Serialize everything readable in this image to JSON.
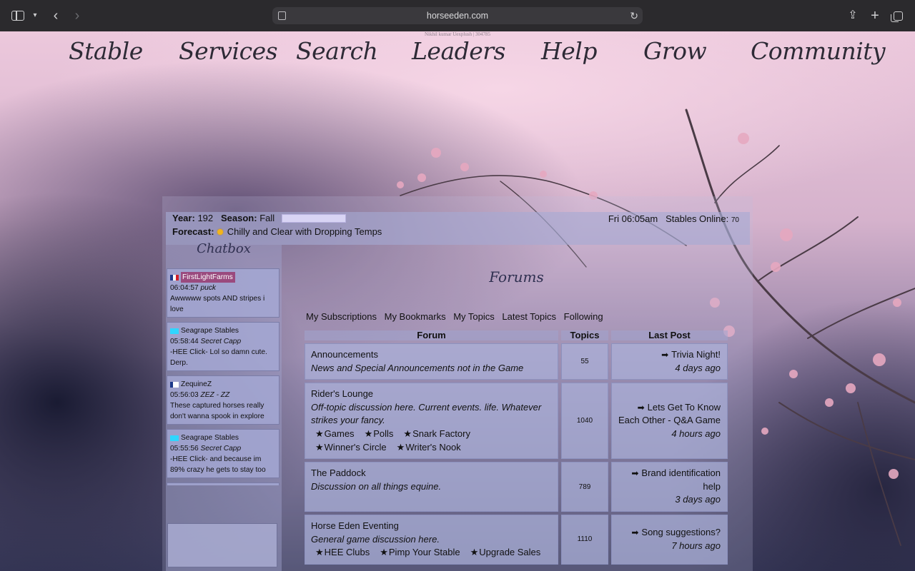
{
  "browser": {
    "url": "horseeden.com",
    "icons": {
      "sidebar": "sidebar-icon",
      "back": "chevron-left-icon",
      "forward": "chevron-right-icon",
      "share": "share-icon",
      "new_tab": "plus-icon",
      "tabs": "tabs-overview-icon"
    }
  },
  "annotation": "Nikhil kumar Uexplush | 304785",
  "nav": {
    "stable": "Stable",
    "services": "Services",
    "search": "Search",
    "leaders": "Leaders",
    "help": "Help",
    "grow": "Grow",
    "community": "Community"
  },
  "info": {
    "year_label": "Year:",
    "year": "192",
    "season_label": "Season:",
    "season": "Fall",
    "forecast_label": "Forecast:",
    "forecast": "Chilly and Clear with Dropping Temps",
    "time": "Fri 06:05am",
    "stables_online_label": "Stables Online:",
    "stables_online": "70"
  },
  "chatbox": {
    "title": "Chatbox",
    "messages": [
      {
        "user": "FirstLightFarms",
        "time": "06:04:57",
        "alias": "puck",
        "text": "Awwwww spots AND stripes i love"
      },
      {
        "user": "Seagrape Stables",
        "time": "05:58:44",
        "alias": "Secret Capp",
        "text": "-HEE Click- Lol so damn cute. Derp."
      },
      {
        "user": "ZequineZ",
        "time": "05:56:03",
        "alias": "ZEZ - ZZ",
        "text": "These captured horses really don't wanna spook in explore"
      },
      {
        "user": "Seagrape Stables",
        "time": "05:55:56",
        "alias": "Secret Capp",
        "text": "-HEE Click- and because im 89% crazy he gets to stay too"
      }
    ]
  },
  "forums": {
    "title": "Forums",
    "tabs": [
      "My Subscriptions",
      "My Bookmarks",
      "My Topics",
      "Latest Topics",
      "Following"
    ],
    "headers": {
      "forum": "Forum",
      "topics": "Topics",
      "last_post": "Last Post"
    },
    "rows": [
      {
        "name": "Announcements",
        "desc": "News and Special Announcements not in the Game",
        "subforums": [],
        "topics": "55",
        "last_post": "Trivia Night!",
        "ago": "4 days ago"
      },
      {
        "name": "Rider's Lounge",
        "desc": "Off-topic discussion here. Current events. life. Whatever strikes your fancy.",
        "subforums": [
          "Games",
          "Polls",
          "Snark Factory",
          "Winner's Circle",
          "Writer's Nook"
        ],
        "topics": "1040",
        "last_post": "Lets Get To Know Each Other - Q&A Game",
        "ago": "4 hours ago"
      },
      {
        "name": "The Paddock",
        "desc": "Discussion on all things equine.",
        "subforums": [],
        "topics": "789",
        "last_post": "Brand identification help",
        "ago": "3 days ago"
      },
      {
        "name": "Horse Eden Eventing",
        "desc": "General game discussion here.",
        "subforums": [
          "HEE Clubs",
          "Pimp Your Stable",
          "Upgrade Sales"
        ],
        "topics": "1110",
        "last_post": "Song suggestions?",
        "ago": "7 hours ago"
      }
    ]
  }
}
